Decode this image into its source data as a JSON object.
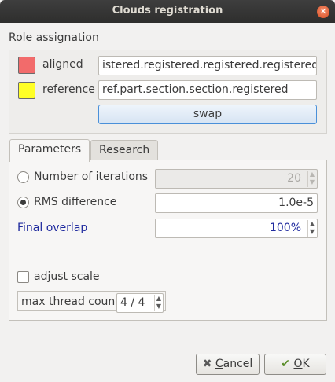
{
  "window": {
    "title": "Clouds registration",
    "close_icon": "close-icon"
  },
  "roles": {
    "section_title": "Role assignation",
    "aligned": {
      "label": "aligned",
      "value": "istered.registered.registered.registered",
      "color": "#f26b6b"
    },
    "reference": {
      "label": "reference",
      "value": "ref.part.section.section.registered",
      "color": "#ffff26"
    },
    "swap_label": "swap"
  },
  "tabs": [
    {
      "label": "Parameters",
      "active": true
    },
    {
      "label": "Research",
      "active": false
    }
  ],
  "parameters": {
    "iterations": {
      "label": "Number of iterations",
      "value": "20",
      "selected": false,
      "enabled": false
    },
    "rms": {
      "label": "RMS difference",
      "value": "1.0e-5",
      "selected": true
    },
    "overlap": {
      "label": "Final overlap",
      "value": "100%",
      "color": "#1f2a9e"
    },
    "adjust_scale": {
      "label": "adjust scale",
      "checked": false
    },
    "threads": {
      "label": "max thread count",
      "value": "4 / 4"
    }
  },
  "footer": {
    "cancel_label": "Cancel",
    "cancel_mnemonic": "C",
    "ok_label": "OK",
    "ok_mnemonic": "O"
  }
}
